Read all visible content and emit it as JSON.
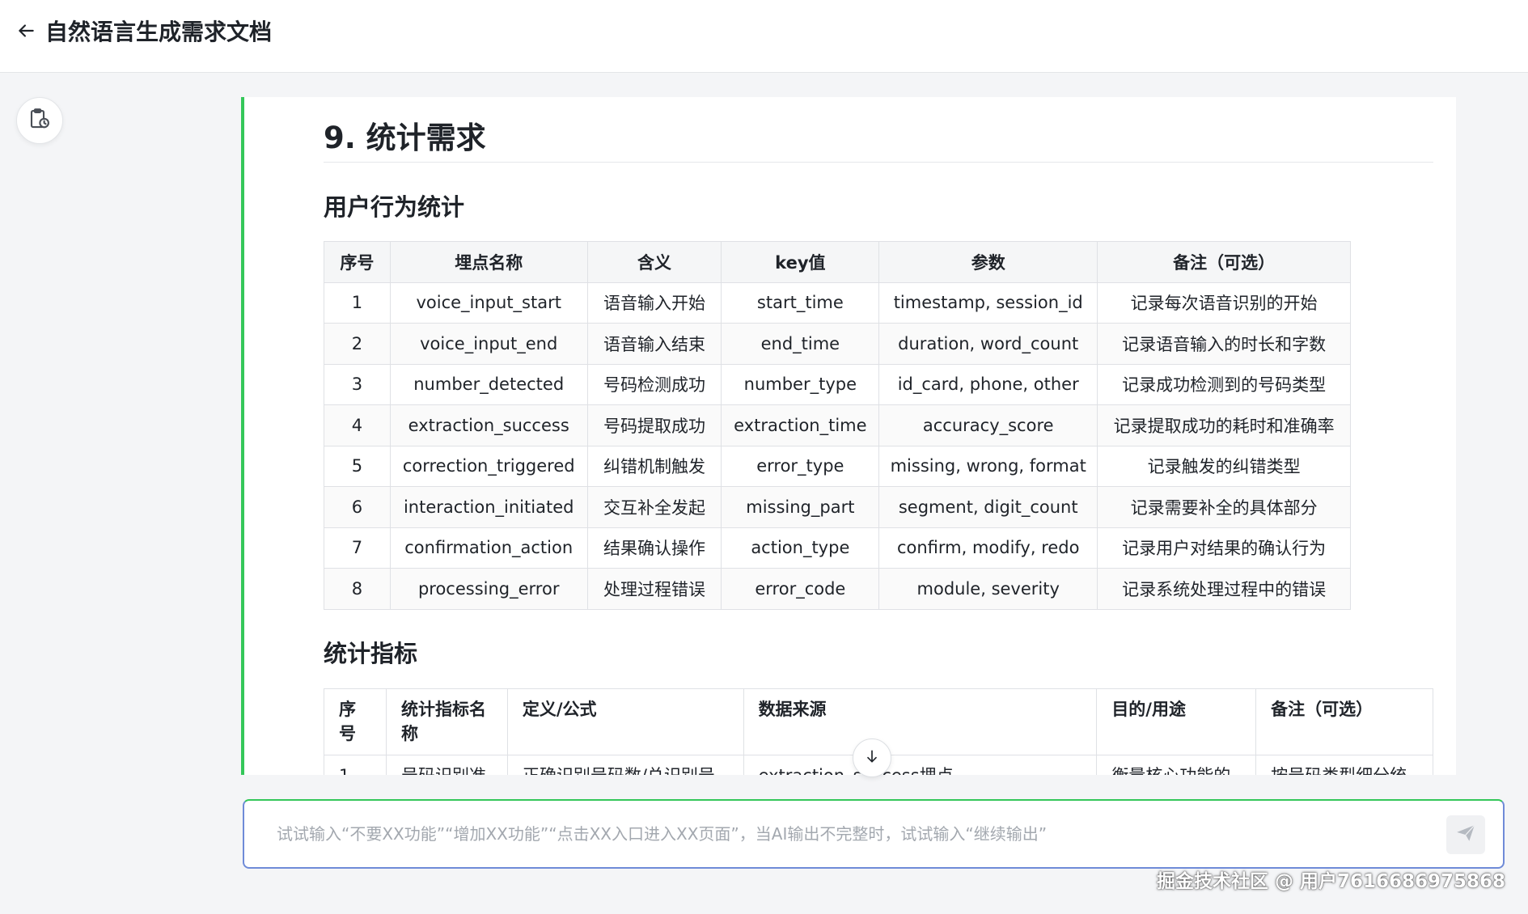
{
  "header": {
    "title": "自然语言生成需求文档",
    "back_icon": "arrow-left-icon"
  },
  "sidebar": {
    "history_icon": "clipboard-clock-icon"
  },
  "doc": {
    "section_title": "9. 统计需求",
    "behavior_heading": "用户行为统计",
    "behavior_table": {
      "headers": [
        "序号",
        "埋点名称",
        "含义",
        "key值",
        "参数",
        "备注（可选）"
      ],
      "rows": [
        [
          "1",
          "voice_input_start",
          "语音输入开始",
          "start_time",
          "timestamp, session_id",
          "记录每次语音识别的开始"
        ],
        [
          "2",
          "voice_input_end",
          "语音输入结束",
          "end_time",
          "duration, word_count",
          "记录语音输入的时长和字数"
        ],
        [
          "3",
          "number_detected",
          "号码检测成功",
          "number_type",
          "id_card, phone, other",
          "记录成功检测到的号码类型"
        ],
        [
          "4",
          "extraction_success",
          "号码提取成功",
          "extraction_time",
          "accuracy_score",
          "记录提取成功的耗时和准确率"
        ],
        [
          "5",
          "correction_triggered",
          "纠错机制触发",
          "error_type",
          "missing, wrong, format",
          "记录触发的纠错类型"
        ],
        [
          "6",
          "interaction_initiated",
          "交互补全发起",
          "missing_part",
          "segment, digit_count",
          "记录需要补全的具体部分"
        ],
        [
          "7",
          "confirmation_action",
          "结果确认操作",
          "action_type",
          "confirm, modify, redo",
          "记录用户对结果的确认行为"
        ],
        [
          "8",
          "processing_error",
          "处理过程错误",
          "error_code",
          "module, severity",
          "记录系统处理过程中的错误"
        ]
      ]
    },
    "metrics_heading": "统计指标",
    "metrics_table": {
      "headers": [
        "序号",
        "统计指标名称",
        "定义/公式",
        "数据来源",
        "目的/用途",
        "备注（可选）"
      ],
      "partial_row": [
        "1",
        "号码识别准",
        "正确识别号码数/总识别号",
        "extraction_success埋点",
        "衡量核心功能的",
        "按号码类型细分统"
      ]
    }
  },
  "scroll_down_icon": "arrow-down-icon",
  "input": {
    "placeholder": "试试输入“不要XX功能”“增加XX功能”“点击XX入口进入XX页面”，当AI输出不完整时，试试输入“继续输出”",
    "value": ""
  },
  "send_icon": "paper-plane-icon",
  "footer_watermark": "掘金技术社区 @ 用户7616686975868",
  "colors": {
    "accent_green": "#34c759",
    "input_border": "#6f8bd8",
    "page_bg": "#f4f5f7"
  }
}
